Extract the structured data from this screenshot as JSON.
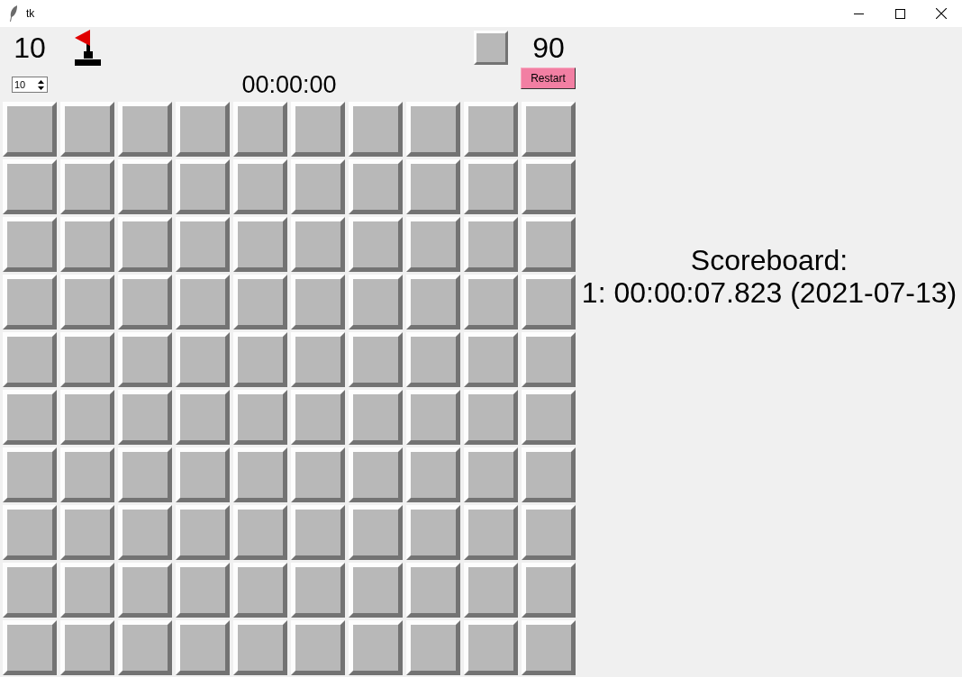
{
  "window": {
    "title": "tk"
  },
  "toolbar": {
    "flag_count": "10",
    "spinbox": {
      "value": "10"
    },
    "timer": "00:00:00",
    "tile_count": "90",
    "restart_button": {
      "label": "Restart"
    }
  },
  "board": {
    "rows": [
      {
        "cells": [
          {
            "revealed": false
          },
          {
            "revealed": false
          },
          {
            "revealed": false
          },
          {
            "revealed": false
          },
          {
            "revealed": false
          },
          {
            "revealed": false
          },
          {
            "revealed": false
          },
          {
            "revealed": false
          },
          {
            "revealed": false
          },
          {
            "revealed": false
          }
        ]
      },
      {
        "cells": [
          {
            "revealed": false
          },
          {
            "revealed": false
          },
          {
            "revealed": false
          },
          {
            "revealed": false
          },
          {
            "revealed": false
          },
          {
            "revealed": false
          },
          {
            "revealed": false
          },
          {
            "revealed": false
          },
          {
            "revealed": false
          },
          {
            "revealed": false
          }
        ]
      },
      {
        "cells": [
          {
            "revealed": false
          },
          {
            "revealed": false
          },
          {
            "revealed": false
          },
          {
            "revealed": false
          },
          {
            "revealed": false
          },
          {
            "revealed": false
          },
          {
            "revealed": false
          },
          {
            "revealed": false
          },
          {
            "revealed": false
          },
          {
            "revealed": false
          }
        ]
      },
      {
        "cells": [
          {
            "revealed": false
          },
          {
            "revealed": false
          },
          {
            "revealed": false
          },
          {
            "revealed": false
          },
          {
            "revealed": false
          },
          {
            "revealed": false
          },
          {
            "revealed": false
          },
          {
            "revealed": false
          },
          {
            "revealed": false
          },
          {
            "revealed": false
          }
        ]
      },
      {
        "cells": [
          {
            "revealed": false
          },
          {
            "revealed": false
          },
          {
            "revealed": false
          },
          {
            "revealed": false
          },
          {
            "revealed": false
          },
          {
            "revealed": false
          },
          {
            "revealed": false
          },
          {
            "revealed": false
          },
          {
            "revealed": false
          },
          {
            "revealed": false
          }
        ]
      },
      {
        "cells": [
          {
            "revealed": false
          },
          {
            "revealed": false
          },
          {
            "revealed": false
          },
          {
            "revealed": false
          },
          {
            "revealed": false
          },
          {
            "revealed": false
          },
          {
            "revealed": false
          },
          {
            "revealed": false
          },
          {
            "revealed": false
          },
          {
            "revealed": false
          }
        ]
      },
      {
        "cells": [
          {
            "revealed": false
          },
          {
            "revealed": false
          },
          {
            "revealed": false
          },
          {
            "revealed": false
          },
          {
            "revealed": false
          },
          {
            "revealed": false
          },
          {
            "revealed": false
          },
          {
            "revealed": false
          },
          {
            "revealed": false
          },
          {
            "revealed": false
          }
        ]
      },
      {
        "cells": [
          {
            "revealed": false
          },
          {
            "revealed": false
          },
          {
            "revealed": false
          },
          {
            "revealed": false
          },
          {
            "revealed": false
          },
          {
            "revealed": false
          },
          {
            "revealed": false
          },
          {
            "revealed": false
          },
          {
            "revealed": false
          },
          {
            "revealed": false
          }
        ]
      },
      {
        "cells": [
          {
            "revealed": false
          },
          {
            "revealed": false
          },
          {
            "revealed": false
          },
          {
            "revealed": false
          },
          {
            "revealed": false
          },
          {
            "revealed": false
          },
          {
            "revealed": false
          },
          {
            "revealed": false
          },
          {
            "revealed": false
          },
          {
            "revealed": false
          }
        ]
      },
      {
        "cells": [
          {
            "revealed": false
          },
          {
            "revealed": false
          },
          {
            "revealed": false
          },
          {
            "revealed": false
          },
          {
            "revealed": false
          },
          {
            "revealed": false
          },
          {
            "revealed": false
          },
          {
            "revealed": false
          },
          {
            "revealed": false
          },
          {
            "revealed": false
          }
        ]
      }
    ]
  },
  "scoreboard": {
    "title": "Scoreboard:",
    "entries": [
      "1: 00:00:07.823 (2021-07-13)"
    ]
  }
}
